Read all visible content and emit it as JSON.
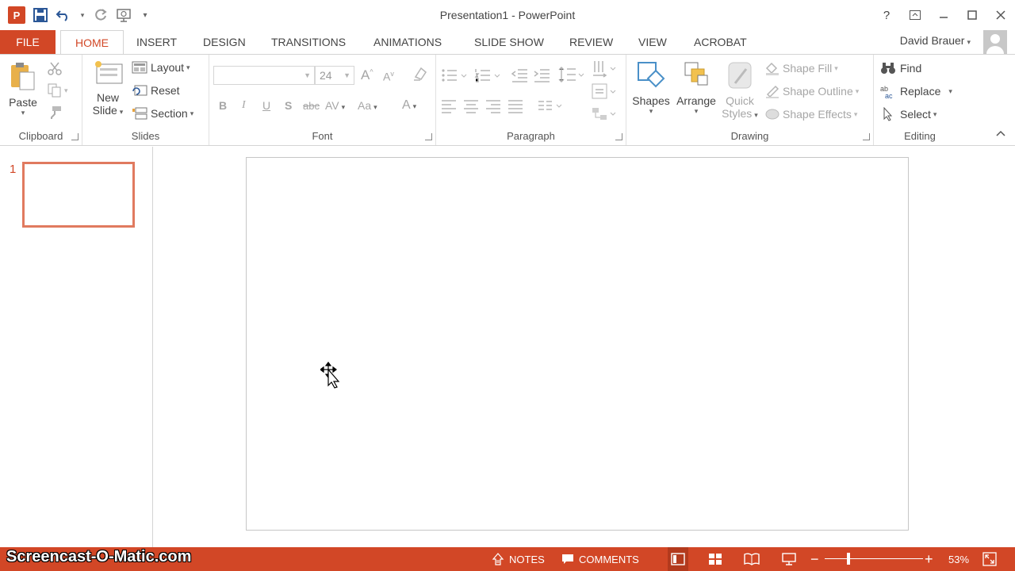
{
  "window": {
    "title": "Presentation1 - PowerPoint",
    "app_badge": "P",
    "help": "?"
  },
  "tabs": {
    "file": "FILE",
    "items": [
      "HOME",
      "INSERT",
      "DESIGN",
      "TRANSITIONS",
      "ANIMATIONS",
      "SLIDE SHOW",
      "REVIEW",
      "VIEW",
      "ACROBAT"
    ],
    "active": "HOME"
  },
  "user": {
    "name": "David Brauer"
  },
  "ribbon": {
    "clipboard": {
      "label": "Clipboard",
      "paste": "Paste"
    },
    "slides": {
      "label": "Slides",
      "new_slide_1": "New",
      "new_slide_2": "Slide",
      "layout": "Layout",
      "reset": "Reset",
      "section": "Section"
    },
    "font": {
      "label": "Font",
      "font_name": "",
      "font_size": "24",
      "bold": "B",
      "italic": "I",
      "underline": "U",
      "shadow": "S",
      "strike": "abc",
      "spacing": "AV",
      "case": "Aa",
      "color": "A"
    },
    "paragraph": {
      "label": "Paragraph"
    },
    "drawing": {
      "label": "Drawing",
      "shapes": "Shapes",
      "arrange": "Arrange",
      "quick_styles_1": "Quick",
      "quick_styles_2": "Styles",
      "shape_fill": "Shape Fill",
      "shape_outline": "Shape Outline",
      "shape_effects": "Shape Effects"
    },
    "editing": {
      "label": "Editing",
      "find": "Find",
      "replace": "Replace",
      "select": "Select"
    }
  },
  "slides_panel": {
    "slide_number": "1"
  },
  "status": {
    "watermark": "Screencast-O-Matic.com",
    "notes": "NOTES",
    "comments": "COMMENTS",
    "zoom_percent": "53%",
    "zoom_level": 0.53,
    "zoom_minus": "−",
    "zoom_plus": "+"
  },
  "colors": {
    "accent": "#d24726",
    "thumb_border": "#e07a5f"
  }
}
